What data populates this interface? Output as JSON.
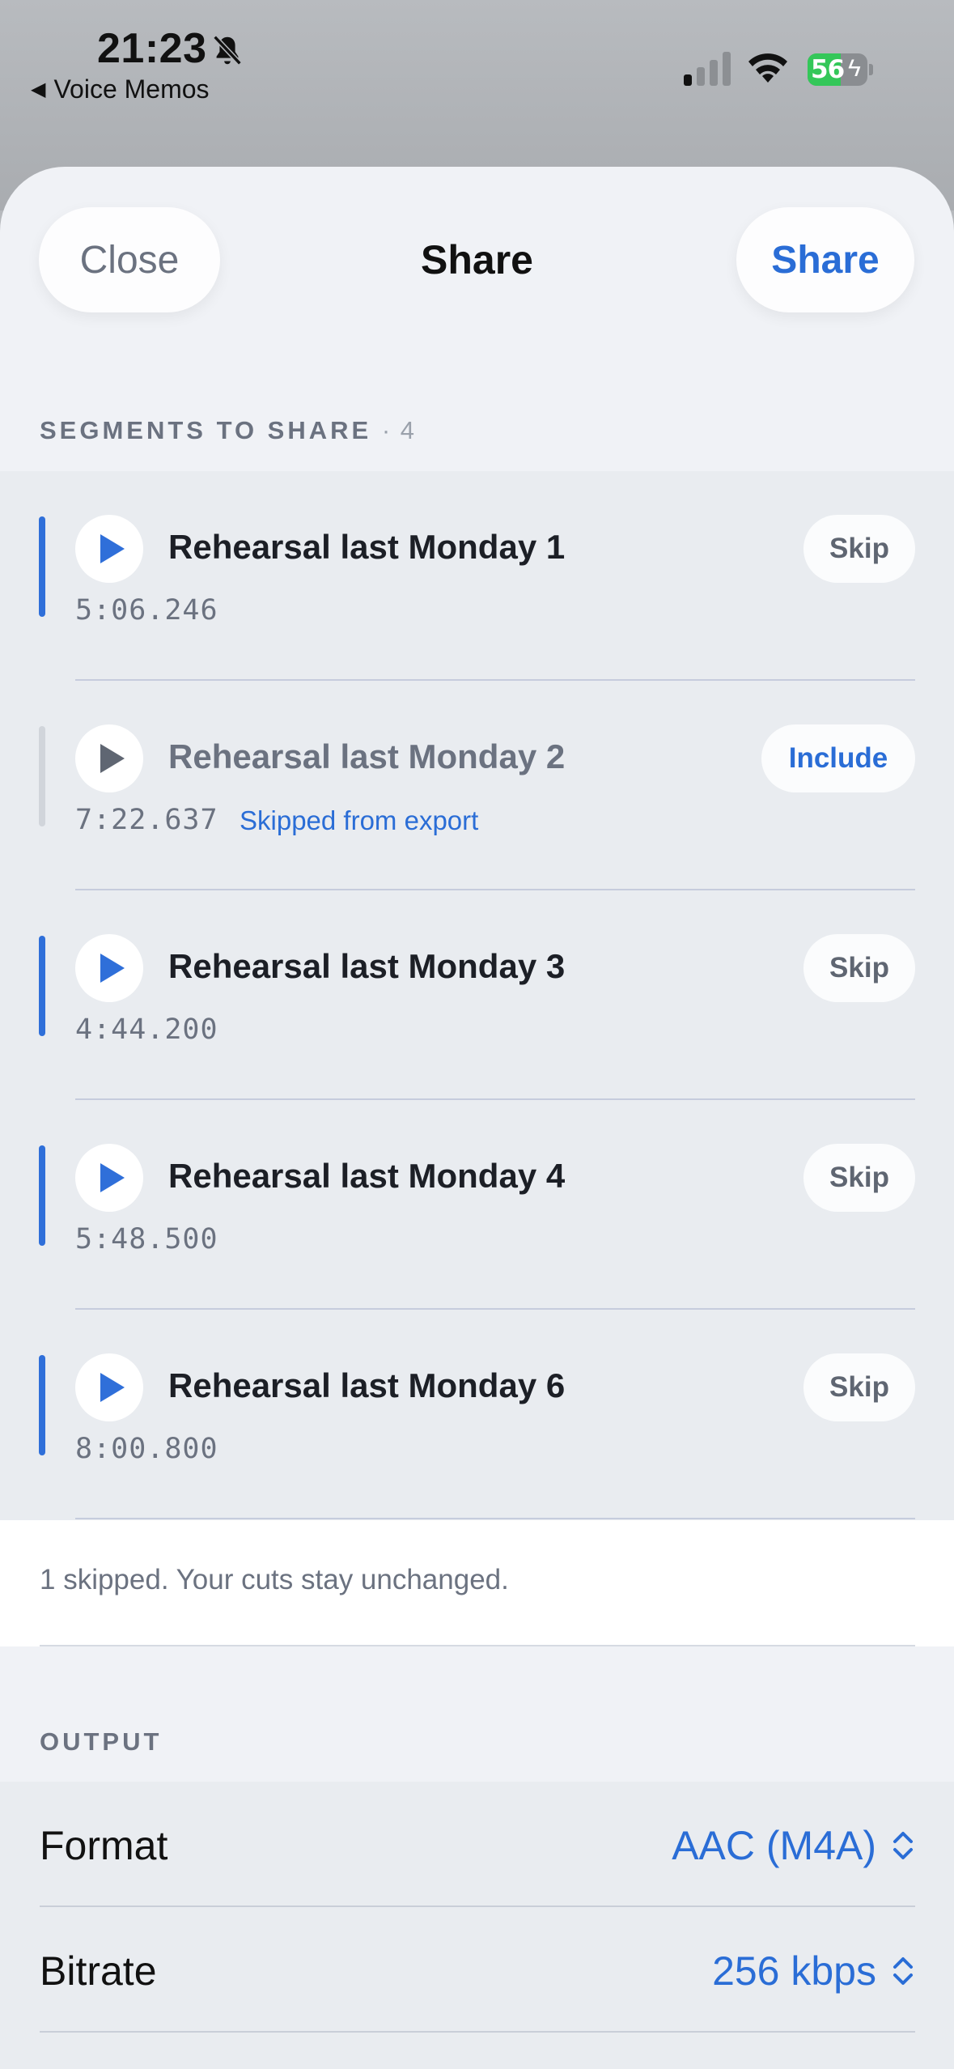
{
  "status": {
    "time": "21:23",
    "back_app": "Voice Memos",
    "battery_level": "56",
    "battery_fraction": 0.56
  },
  "header": {
    "close_label": "Close",
    "title": "Share",
    "share_label": "Share"
  },
  "segments_section": {
    "label": "SEGMENTS TO SHARE",
    "count": "· 4"
  },
  "segments": [
    {
      "title": "Rehearsal last Monday 1",
      "duration": "5:06.246",
      "action": "Skip",
      "note": ""
    },
    {
      "title": "Rehearsal last Monday 2",
      "duration": "7:22.637",
      "action": "Include",
      "note": "Skipped from export"
    },
    {
      "title": "Rehearsal last Monday 3",
      "duration": "4:44.200",
      "action": "Skip",
      "note": ""
    },
    {
      "title": "Rehearsal last Monday 4",
      "duration": "5:48.500",
      "action": "Skip",
      "note": ""
    },
    {
      "title": "Rehearsal last Monday 6",
      "duration": "8:00.800",
      "action": "Skip",
      "note": ""
    }
  ],
  "footnote": "1 skipped. Your cuts stay unchanged.",
  "output": {
    "label": "OUTPUT",
    "format_label": "Format",
    "format_value": "AAC (M4A)",
    "bitrate_label": "Bitrate",
    "bitrate_value": "256 kbps"
  },
  "colors": {
    "accent": "#2a6dd6",
    "included_bar": "#2f6fd9",
    "skipped_bar": "#d1d5db",
    "battery": "#34c759"
  },
  "icons": [
    "bell-slash-icon",
    "signal-icon",
    "wifi-icon",
    "battery-icon",
    "play-icon",
    "chevron-updown-icon"
  ]
}
